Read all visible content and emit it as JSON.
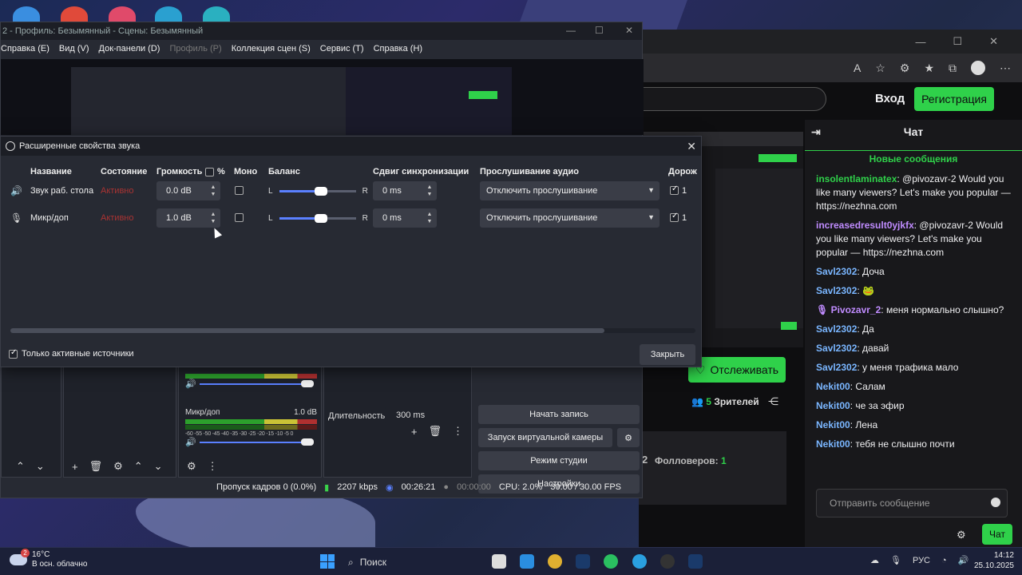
{
  "browser": {
    "login_label": "Вход",
    "register_label": "Регистрация",
    "follow_label": "Отслеживать",
    "viewers_count": "5",
    "viewers_label": "Зрителей",
    "followers_prefix": "2",
    "followers_label": "Фолловеров:",
    "followers_count": "1"
  },
  "chat": {
    "title": "Чат",
    "new_messages": "Новые сообщения",
    "messages": [
      {
        "user": "insolentlaminatex",
        "color": "#2fd14a",
        "text": ": @pivozavr-2 Would you like many viewers? Let's make you popular — https://nezhna.com"
      },
      {
        "user": "increasedresult0yjkfx",
        "color": "#c08cff",
        "text": ": @pivozavr-2 Would you like many viewers? Let's make you popular — https://nezhna.com"
      },
      {
        "user": "Savl2302",
        "color": "#7ab6ff",
        "text": ": Доча"
      },
      {
        "user": "Savl2302",
        "color": "#7ab6ff",
        "text": ": 🐸"
      },
      {
        "user": "🎙 Pivozavr_2",
        "color": "#c08cff",
        "text": ": меня нормально слышно?"
      },
      {
        "user": "Savl2302",
        "color": "#7ab6ff",
        "text": ": Да"
      },
      {
        "user": "Savl2302",
        "color": "#7ab6ff",
        "text": ": давай"
      },
      {
        "user": "Savl2302",
        "color": "#7ab6ff",
        "text": ": у меня трафика мало"
      },
      {
        "user": "Nekit00",
        "color": "#7ab6ff",
        "text": ": Салам"
      },
      {
        "user": "Nekit00",
        "color": "#7ab6ff",
        "text": ": че за эфир"
      },
      {
        "user": "Nekit00",
        "color": "#7ab6ff",
        "text": ": Лена"
      },
      {
        "user": "Nekit00",
        "color": "#7ab6ff",
        "text": ": тебя не слышно почти"
      }
    ],
    "input_placeholder": "Отправить сообщение",
    "send_label": "Чат"
  },
  "obs": {
    "title": "2 - Профиль: Безымянный - Сцены: Безымянный",
    "menu": [
      {
        "label": "Справка (E)",
        "disabled": false
      },
      {
        "label": "Вид (V)",
        "disabled": false
      },
      {
        "label": "Док-панели (D)",
        "disabled": false
      },
      {
        "label": "Профиль (P)",
        "disabled": true
      },
      {
        "label": "Коллекция сцен (S)",
        "disabled": false
      },
      {
        "label": "Сервис (T)",
        "disabled": false
      },
      {
        "label": "Справка (H)",
        "disabled": false
      }
    ],
    "mixer": {
      "mic_name": "Микр/доп",
      "mic_level": "1.0 dB",
      "scale": "-60 -55 -50 -45 -40 -35 -30 -25 -20 -15 -10 -5 0"
    },
    "transition_duration_label": "Длительность",
    "transition_duration_value": "300 ms",
    "controls": {
      "start_recording": "Начать запись",
      "virtual_camera": "Запуск виртуальной камеры",
      "studio_mode": "Режим студии",
      "settings": "Настройки"
    },
    "status": {
      "dropped_frames": "Пропуск кадров 0 (0.0%)",
      "bitrate": "2207 kbps",
      "stream_time": "00:26:21",
      "record_time": "00:00:00",
      "cpu": "CPU: 2.0%",
      "fps": "30.00 / 30.00 FPS"
    }
  },
  "dialog": {
    "title": "Расширенные свойства звука",
    "columns": {
      "name": "Название",
      "state": "Состояние",
      "volume": "Громкость",
      "volume_percent": "%",
      "mono": "Моно",
      "balance": "Баланс",
      "sync_offset": "Сдвиг синхронизации",
      "monitoring": "Прослушивание аудио",
      "tracks": "Дорож"
    },
    "balance_left": "L",
    "balance_right": "R",
    "sources": [
      {
        "name": "Звук раб. стола",
        "icon": "speaker-icon",
        "state": "Активно",
        "volume": "0.0 dB",
        "mono": false,
        "balance": 0.5,
        "sync": "0 ms",
        "monitoring": "Отключить прослушивание",
        "track": "1"
      },
      {
        "name": "Микр/доп",
        "icon": "microphone-icon",
        "state": "Активно",
        "volume": "1.0 dB",
        "mono": false,
        "balance": 0.5,
        "sync": "0 ms",
        "monitoring": "Отключить прослушивание",
        "track": "1"
      }
    ],
    "only_active_label": "Только активные источники",
    "only_active_checked": true,
    "close_label": "Закрыть"
  },
  "taskbar": {
    "weather_temp": "16°C",
    "weather_desc": "В осн. облачно",
    "weather_badge": "2",
    "search_placeholder": "Поиск",
    "language": "РУС",
    "time": "14:12",
    "date": "25.10.2025"
  }
}
